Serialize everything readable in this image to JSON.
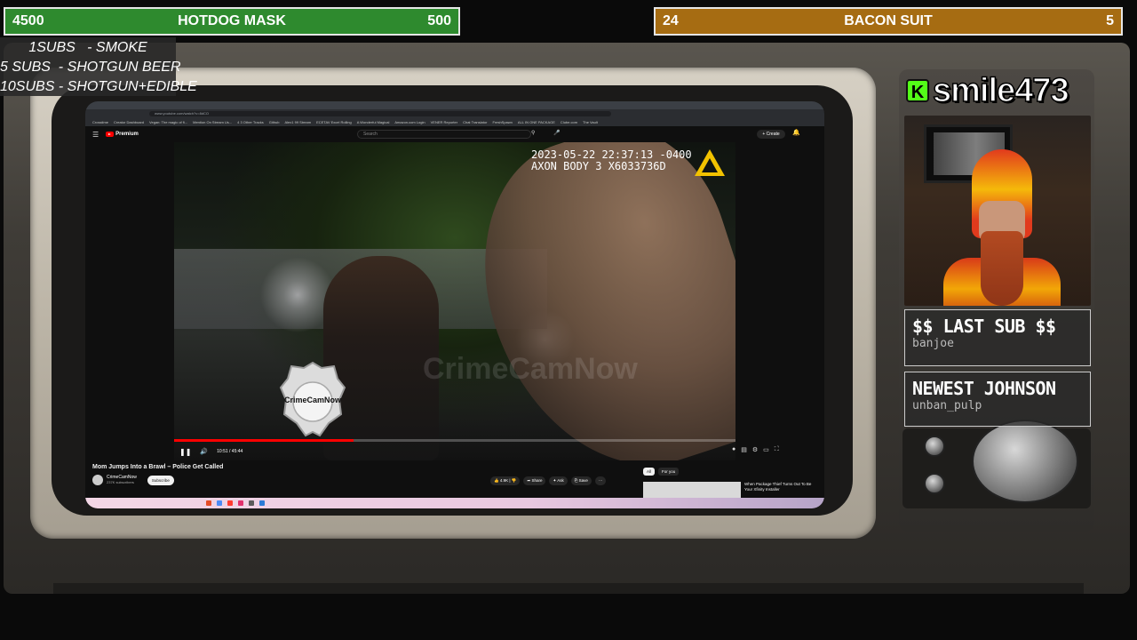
{
  "goals": {
    "left": {
      "current": "4500",
      "title": "HOTDOG MASK",
      "target": "500"
    },
    "right": {
      "current": "24",
      "title": "BACON SUIT",
      "target": "5"
    }
  },
  "sub_rules": [
    "1SUBS   - SMOKE",
    "5 SUBS  - SHOTGUN BEER",
    "10SUBS - SHOTGUN+EDIBLE"
  ],
  "browser": {
    "url": "www.youtube.com/watch?v=8dCO",
    "bookmarks": [
      "Crosstime",
      "Creator Dashboard",
      "Vegan: The magic of fi...",
      "Mention On Stream Us...",
      "4 3 Other Tracks",
      "Github",
      "Alex1 99 Stream",
      "ECETAV Excel Rolling",
      "A Wonderful Magical",
      "Amazon.com Login",
      "VENER Reporter",
      "Chat Translator",
      "FreshSpawn",
      "ALL IN ONE PACKAGE",
      "Clube.com",
      "The Vault"
    ]
  },
  "youtube": {
    "brand": "Premium",
    "search_placeholder": "Search",
    "create_label": "Create",
    "video": {
      "timestamp_line1": "2023-05-22 22:37:13 -0400",
      "timestamp_line2": "AXON BODY 3 X6033736D",
      "watermark": "CrimeCamNow",
      "badge_label": "CrimeCamNow",
      "time": "10:51 / 45:44",
      "progress": 0.32
    },
    "title": "Mom Jumps Into a Brawl – Police Get Called",
    "channel": {
      "name": "CrimeCamNow",
      "subs": "237K subscribers",
      "subscribe_label": "Subscribe"
    },
    "actions": {
      "likes": "4.9K",
      "share": "Share",
      "ask": "Ask",
      "save": "Save",
      "more": "···"
    },
    "chips": {
      "all": "All",
      "for_you": "For you"
    },
    "related_title": "When Package Thief Turns Out To Be Your Xfinity Installer"
  },
  "streamer": {
    "name": "smile473",
    "platform_icon": "K"
  },
  "last_sub": {
    "label": "$$ LAST SUB $$",
    "value": "banjoe"
  },
  "newest": {
    "label": "NEWEST JOHNSON",
    "value": "unban_pulp"
  }
}
